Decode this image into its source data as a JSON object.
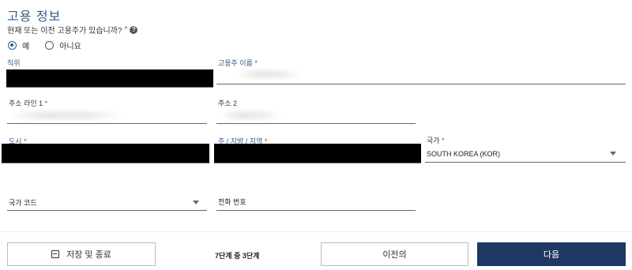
{
  "section": {
    "title": "고용 정보",
    "question": "현재 또는 이전 고용주가 있습니까?",
    "required_mark": "*"
  },
  "employment_radio": {
    "options": [
      "예",
      "아니요"
    ],
    "selected": "예"
  },
  "fields": {
    "job_title": {
      "label": "직위",
      "value": ""
    },
    "employer_name": {
      "label": "고용주 이름",
      "value": ""
    },
    "address_line1": {
      "label": "주소 라인 1",
      "value": ""
    },
    "address_line2": {
      "label": "주소 2",
      "value": ""
    },
    "city": {
      "label": "도시",
      "value": ""
    },
    "state": {
      "label": "주 / 지방 / 지역",
      "value": ""
    },
    "country": {
      "label": "국가",
      "value": "SOUTH KOREA (KOR)"
    },
    "country_code": {
      "label": "국가 코드",
      "value": ""
    },
    "phone": {
      "label": "전화 번호",
      "value": ""
    }
  },
  "footer": {
    "save_label": "저장 및 종료",
    "step_text": "7단계 중 3단계",
    "prev_label": "이전의",
    "next_label": "다음"
  },
  "colors": {
    "accent": "#2f5d8c",
    "primary_button": "#1f3864",
    "required": "#c0392b"
  },
  "icons": [
    "help-icon",
    "radio-checked-icon",
    "radio-unchecked-icon",
    "chevron-down-icon",
    "save-icon"
  ]
}
